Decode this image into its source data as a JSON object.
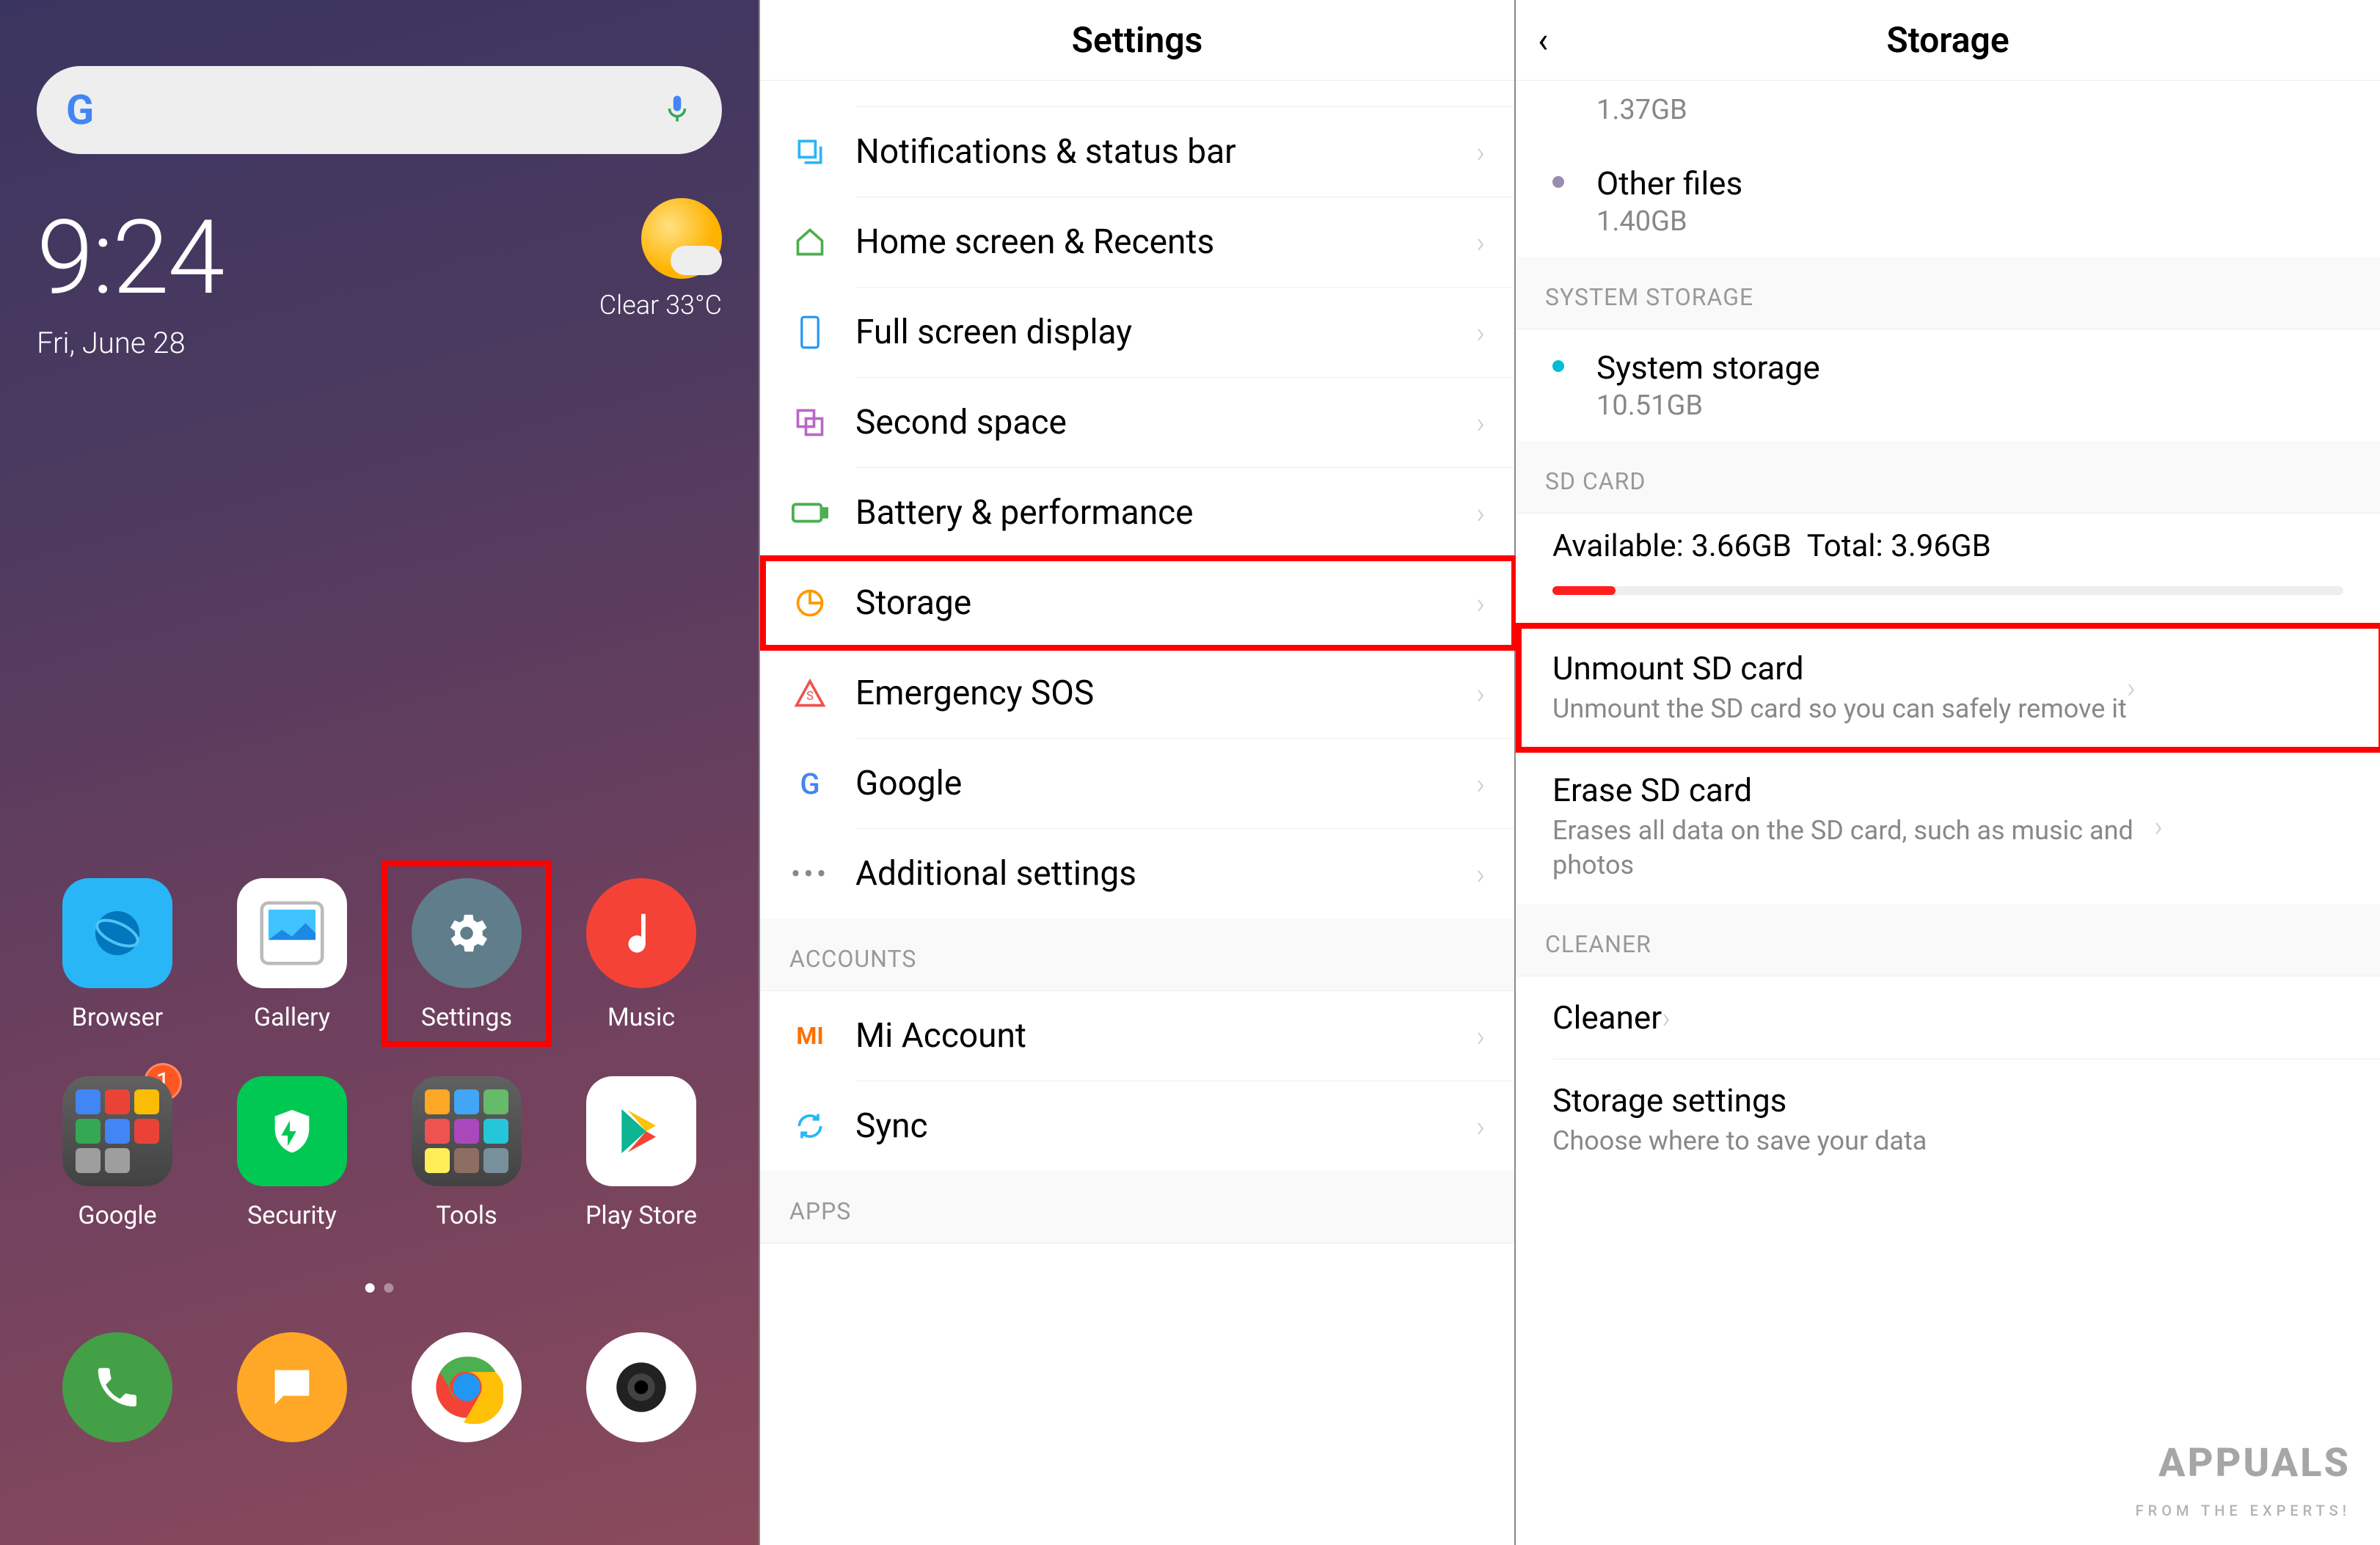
{
  "home": {
    "time": "9:24",
    "date": "Fri, June 28",
    "weather": "Clear  33°C",
    "apps_row1": [
      {
        "label": "Browser",
        "icon": "browser"
      },
      {
        "label": "Gallery",
        "icon": "gallery"
      },
      {
        "label": "Settings",
        "icon": "settings",
        "highlight": true
      },
      {
        "label": "Music",
        "icon": "music"
      }
    ],
    "apps_row2": [
      {
        "label": "Google",
        "icon": "folder-google",
        "badge": "1"
      },
      {
        "label": "Security",
        "icon": "security"
      },
      {
        "label": "Tools",
        "icon": "folder-tools"
      },
      {
        "label": "Play Store",
        "icon": "playstore"
      }
    ],
    "dock": [
      {
        "label": "Phone",
        "icon": "phone"
      },
      {
        "label": "Messages",
        "icon": "messages"
      },
      {
        "label": "Chrome",
        "icon": "chrome"
      },
      {
        "label": "Camera",
        "icon": "camera"
      }
    ]
  },
  "settings": {
    "title": "Settings",
    "items": [
      {
        "label": "Notifications & status bar",
        "icon": "notif",
        "color": "#29b6f6"
      },
      {
        "label": "Home screen & Recents",
        "icon": "home",
        "color": "#4caf50"
      },
      {
        "label": "Full screen display",
        "icon": "fullscreen",
        "color": "#2196f3"
      },
      {
        "label": "Second space",
        "icon": "secondspace",
        "color": "#ba68c8"
      },
      {
        "label": "Battery & performance",
        "icon": "battery",
        "color": "#4caf50"
      },
      {
        "label": "Storage",
        "icon": "storage",
        "color": "#ff9800",
        "highlight": true
      },
      {
        "label": "Emergency SOS",
        "icon": "sos",
        "color": "#ef5350"
      },
      {
        "label": "Google",
        "icon": "google_g",
        "color": "#4285F4"
      },
      {
        "label": "Additional settings",
        "icon": "dots",
        "color": "#888"
      }
    ],
    "section2": "ACCOUNTS",
    "items2": [
      {
        "label": "Mi Account",
        "icon": "mi",
        "color": "#ff6f00"
      },
      {
        "label": "Sync",
        "icon": "sync",
        "color": "#29b6f6"
      }
    ],
    "section3": "APPS"
  },
  "storage": {
    "title": "Storage",
    "top_size": "1.37GB",
    "other_files": {
      "title": "Other files",
      "size": "1.40GB",
      "dot": "#9a8bb0"
    },
    "sys_section": "SYSTEM STORAGE",
    "system": {
      "title": "System storage",
      "size": "10.51GB",
      "dot": "#00bcd4"
    },
    "sd_section": "SD CARD",
    "sd_available_label": "Available:",
    "sd_available": "3.66GB",
    "sd_total_label": "Total:",
    "sd_total": "3.96GB",
    "sd_used_pct": 8,
    "unmount": {
      "title": "Unmount SD card",
      "sub": "Unmount the SD card so you can safely remove it",
      "highlight": true
    },
    "erase": {
      "title": "Erase SD card",
      "sub": "Erases all data on the SD card, such as music and photos"
    },
    "cleaner_section": "CLEANER",
    "cleaner": {
      "title": "Cleaner"
    },
    "storage_settings": {
      "title": "Storage settings",
      "sub": "Choose where to save your data"
    }
  },
  "watermark": {
    "main": "APPUALS",
    "sub": "FROM THE EXPERTS!"
  }
}
